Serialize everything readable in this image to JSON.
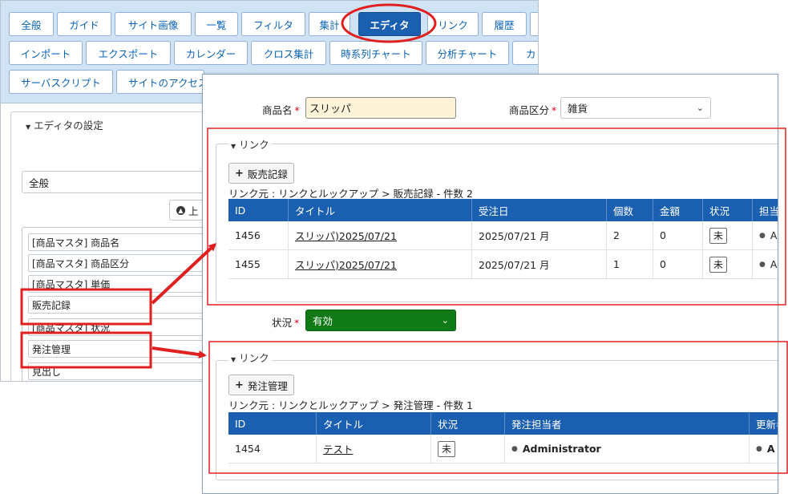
{
  "tabs": {
    "row1": [
      "全般",
      "ガイド",
      "サイト画像",
      "一覧",
      "フィルタ",
      "集計",
      "エディタ",
      "リンク",
      "履歴"
    ],
    "row2": [
      "インポート",
      "エクスポート",
      "カレンダー",
      "クロス集計",
      "時系列チャート",
      "分析チャート",
      "カ"
    ],
    "row3": [
      "サーバスクリプト",
      "サイトのアクセス"
    ],
    "active": "エディタ"
  },
  "editor_settings": {
    "legend": "エディタの設定",
    "section_select": "全般",
    "up_button": "上",
    "columns": [
      "[商品マスタ] 商品名",
      "[商品マスタ] 商品区分",
      "[商品マスタ] 単価",
      "販売記録",
      "[商品マスタ] 状況",
      "発注管理",
      "見出し"
    ]
  },
  "form": {
    "name_label": "商品名",
    "name_value": "スリッパ",
    "category_label": "商品区分",
    "category_value": "雑貨",
    "status_label": "状況",
    "status_value": "有効",
    "required_mark": "*"
  },
  "link1": {
    "legend": "リンク",
    "add_button": "販売記録",
    "breadcrumb": "リンク元 : リンクとルックアップ > 販売記録 - 件数 2",
    "headers": [
      "ID",
      "タイトル",
      "受注日",
      "個数",
      "金額",
      "状況",
      "担当"
    ],
    "rows": [
      {
        "id": "1456",
        "title": "スリッパ)2025/07/21",
        "date": "2025/07/21 月",
        "qty": "2",
        "amount": "0",
        "status": "未",
        "owner": "A"
      },
      {
        "id": "1455",
        "title": "スリッパ)2025/07/21",
        "date": "2025/07/21 月",
        "qty": "1",
        "amount": "0",
        "status": "未",
        "owner": "A"
      }
    ]
  },
  "link2": {
    "legend": "リンク",
    "add_button": "発注管理",
    "breadcrumb": "リンク元 : リンクとルックアップ > 発注管理 - 件数 1",
    "headers": [
      "ID",
      "タイトル",
      "状況",
      "発注担当者",
      "更新者"
    ],
    "rows": [
      {
        "id": "1454",
        "title": "テスト",
        "status": "未",
        "person": "Administrator",
        "updater": "A"
      }
    ]
  },
  "colors": {
    "tab_active": "#1b5fb0",
    "header_blue": "#1b5fb0",
    "status_green": "#0f7a16",
    "annotation_red": "#e02020"
  },
  "icons": {
    "plus": "plus-icon",
    "person": "person-icon",
    "chevron": "chevron-down-icon",
    "arrow_up_circle": "arrow-up-circle-icon"
  }
}
